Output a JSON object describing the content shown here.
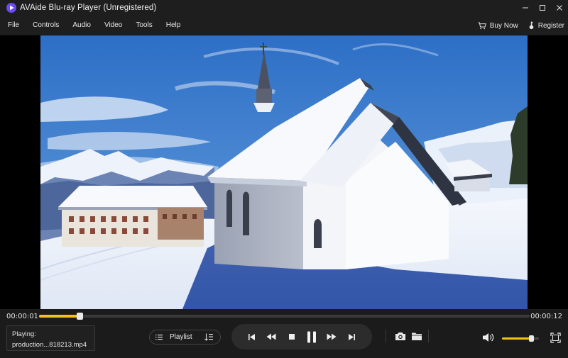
{
  "window": {
    "title": "AVAide Blu-ray Player (Unregistered)"
  },
  "menu": {
    "items": [
      "File",
      "Controls",
      "Audio",
      "Video",
      "Tools",
      "Help"
    ],
    "buy_now": "Buy Now",
    "register": "Register"
  },
  "video": {
    "scene": "snowy mountain chapel"
  },
  "playback": {
    "current_time": "00:00:01",
    "total_time": "00:00:12",
    "progress": 0.083,
    "volume": 0.78
  },
  "now_playing": {
    "label": "Playing:",
    "filename": "production...818213.mp4"
  },
  "playlist": {
    "label": "Playlist"
  },
  "icons": {
    "logo": "play-logo-icon",
    "minimize": "minimize-icon",
    "maximize": "maximize-icon",
    "close": "close-icon",
    "cart": "cart-icon",
    "register": "key-icon",
    "playlist_menu": "list-icon",
    "playlist_sort": "sort-list-icon",
    "prev": "skip-previous-icon",
    "rewind": "rewind-icon",
    "stop": "stop-icon",
    "pause": "pause-icon",
    "forward": "fast-forward-icon",
    "next": "skip-next-icon",
    "snapshot": "camera-icon",
    "open": "folder-icon",
    "volume": "volume-icon",
    "fullscreen": "fullscreen-icon"
  },
  "colors": {
    "accent": "#f2c315",
    "logo": "#6c4cf2",
    "background": "#1b1b1b",
    "sky": "#3d7dd0",
    "snow": "#ffffff"
  }
}
